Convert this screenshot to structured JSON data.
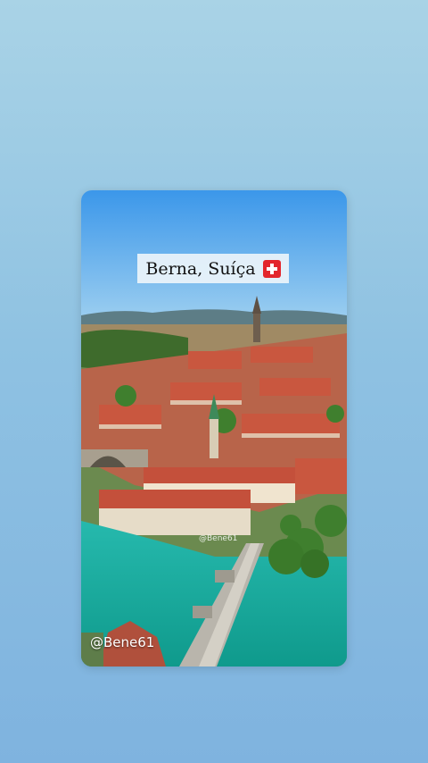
{
  "overlay": {
    "title": "Berna, Suíça",
    "flag_icon": "swiss-flag-icon"
  },
  "watermark": {
    "center": "@Bene61",
    "bottom": "@Bene61"
  },
  "colors": {
    "sky": "#4fa3e8",
    "river": "#1fb3a8",
    "roofs": "#c2553c",
    "trees": "#3f7f2e"
  }
}
